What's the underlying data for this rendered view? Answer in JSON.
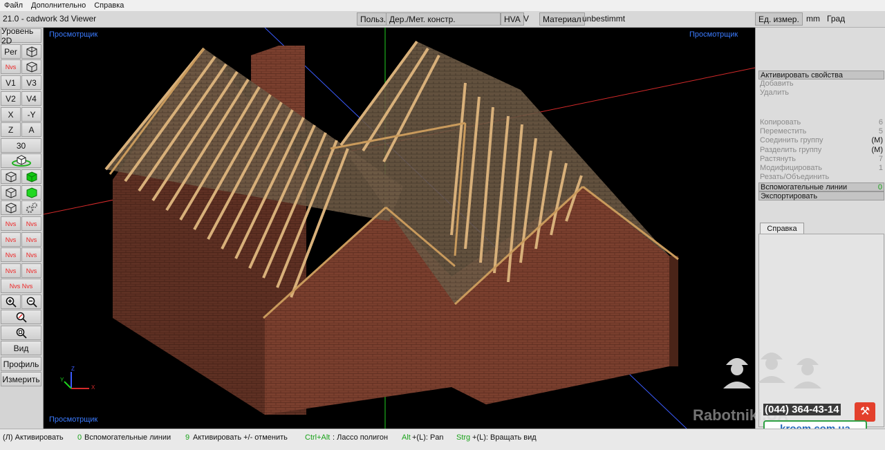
{
  "menu": [
    "Файл",
    "Дополнительно",
    "Справка"
  ],
  "titlebar": {
    "title": "21.0 - cadwork 3d Viewer",
    "user_btn": "Польз.",
    "construction": "Дер./Мет. констр.",
    "hva": "HVA",
    "v": "V",
    "material_label": "Материал",
    "material_value": "unbestimmt",
    "units_label": "Ед. измер.",
    "units_mm": "mm",
    "units_deg": "Град"
  },
  "left_toolbar": {
    "level2d": "Уровень 2D",
    "per": "Per",
    "v1": "V1",
    "v3": "V3",
    "v2": "V2",
    "v4": "V4",
    "x": "X",
    "neg_y": "-Y",
    "z": "Z",
    "a": "A",
    "thirty": "30",
    "red_labels": [
      "Nvs",
      "Nvs",
      "Nvs",
      "Nvs",
      "Nvs",
      "Nvs",
      "Nvs",
      "Nvs",
      "Nvs",
      "Nvs",
      "Nvs",
      "Nvs",
      "Nvs",
      "Nvs",
      "Nvs Nvs"
    ],
    "vid": "Вид",
    "profile": "Профиль",
    "measure": "Измерить"
  },
  "viewport": {
    "label": "Просмотрщик",
    "axes": {
      "x": "X",
      "y": "Y",
      "z": "Z"
    },
    "colors": {
      "background": "#000000",
      "brick": "#7a3f2e",
      "timber": "#d8b07a",
      "axis_green": "#1fd11f",
      "axis_red": "#d42a2a",
      "axis_blue": "#3b5cff"
    }
  },
  "right_panel": {
    "activate_props": "Активировать свойства",
    "add": "Добавить",
    "delete": "Удалить",
    "items": [
      {
        "label": "Копировать",
        "key": "6",
        "enabled": false
      },
      {
        "label": "Переместить",
        "key": "5",
        "enabled": false
      },
      {
        "label": "Соединить группу",
        "key": "(M)",
        "enabled": false
      },
      {
        "label": "Разделить группу",
        "key": "(M)",
        "enabled": false
      },
      {
        "label": "Растянуть",
        "key": "7",
        "enabled": false
      },
      {
        "label": "Модифицировать",
        "key": "1",
        "enabled": false
      },
      {
        "label": "Резать/Объединить",
        "key": "",
        "enabled": false
      },
      {
        "label": "Вспомогательные линии",
        "key": "0",
        "enabled": true
      },
      {
        "label": "Экспортировать",
        "key": "",
        "enabled": true
      }
    ],
    "help_tab": "Справка"
  },
  "statusbar": {
    "s1": "(Л) Активировать",
    "s2_key": "0",
    "s2": "Вспомогательные линии",
    "s3_key": "9",
    "s3": "Активировать +/- отменить",
    "s4_key": "Ctrl+Alt",
    "s4": ": Лассо полигон",
    "s5_key": "Alt",
    "s5": "+(L): Pan",
    "s6_key": "Strg",
    "s6": "+(L): Вращать вид"
  },
  "watermark": {
    "brand": "Rabotniki.UA",
    "phone": "(044) 364-43-14",
    "url": "kroem.com.ua"
  }
}
